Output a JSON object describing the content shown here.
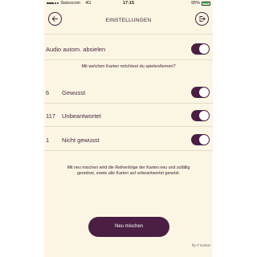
{
  "status_bar": {
    "carrier": "Swisscom",
    "network": "4G",
    "time": "17:15",
    "battery_percent": "95%",
    "battery_level": 0.95
  },
  "header": {
    "title": "EINSTELLUNGEN",
    "back_icon": "arrow-left-circle-icon",
    "exit_icon": "exit-door-icon"
  },
  "audio": {
    "label": "Audio autom. absielen",
    "enabled": true
  },
  "question": "Mit welchen Karten möchtest du spielen/lernen?",
  "card_groups": [
    {
      "count": "6",
      "label": "Gewusst",
      "enabled": true
    },
    {
      "count": "117",
      "label": "Unbeantwortet",
      "enabled": true
    },
    {
      "count": "1",
      "label": "Nicht gewusst",
      "enabled": true
    }
  ],
  "info_text": "Mit neu mischen wird die Reihenfolge der Karten neu und zufällig geordnet, sowie alle Karten auf unbeantwortet gesetzt.",
  "primary_button": "Neu mischen",
  "footer": "fly-T GmbH",
  "colors": {
    "background": "#fbf6e4",
    "accent": "#4a1f43",
    "text": "#4a2540"
  }
}
